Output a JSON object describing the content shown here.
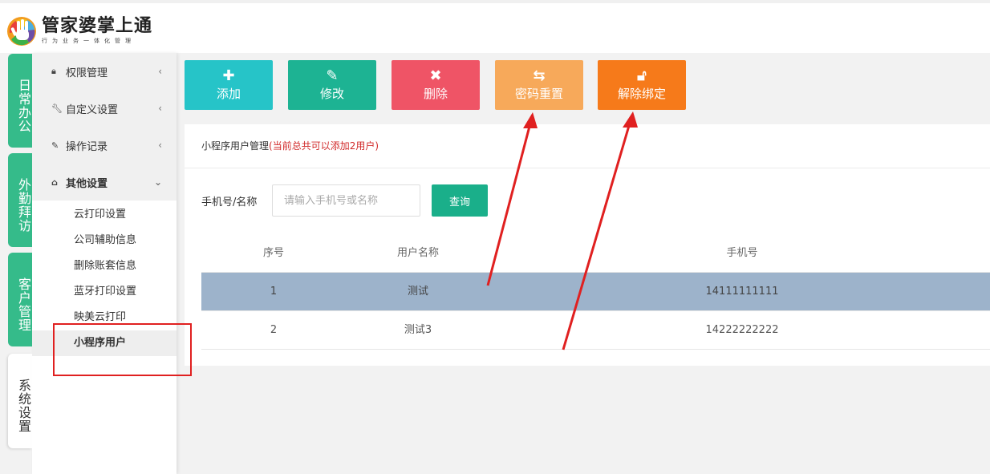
{
  "app": {
    "title": "管家婆掌上通",
    "subtitle": "行为业务一体化管理"
  },
  "vertical_tabs": [
    {
      "label": "日常办公",
      "state": "inactive"
    },
    {
      "label": "外勤拜访",
      "state": "inactive"
    },
    {
      "label": "客户管理",
      "state": "inactive"
    },
    {
      "label": "系统设置",
      "state": "active"
    }
  ],
  "sidebar": {
    "menus": [
      {
        "label": "权限管理",
        "icon": "lock-icon",
        "caret": "‹"
      },
      {
        "label": "自定义设置",
        "icon": "wrench-icon",
        "caret": "‹"
      },
      {
        "label": "操作记录",
        "icon": "edit-icon",
        "caret": "‹"
      },
      {
        "label": "其他设置",
        "icon": "home-icon",
        "caret": "⌄"
      }
    ],
    "sub_items": [
      "云打印设置",
      "公司辅助信息",
      "删除账套信息",
      "蓝牙打印设置",
      "映美云打印",
      "小程序用户"
    ]
  },
  "toolbar": {
    "buttons": [
      {
        "label": "添加",
        "icon": "plus-icon",
        "color": "#26c4c8"
      },
      {
        "label": "修改",
        "icon": "pencil-icon",
        "color": "#1db393"
      },
      {
        "label": "删除",
        "icon": "close-icon",
        "color": "#ef5466"
      },
      {
        "label": "密码重置",
        "icon": "refresh-icon",
        "color": "#f7a95a"
      },
      {
        "label": "解除绑定",
        "icon": "unlock-icon",
        "color": "#f67a1a"
      }
    ]
  },
  "panel": {
    "title": "小程序用户管理",
    "note": "(当前总共可以添加2用户)"
  },
  "search": {
    "label": "手机号/名称",
    "placeholder": "请输入手机号或名称",
    "value": "",
    "button": "查询"
  },
  "table": {
    "headers": [
      "序号",
      "用户名称",
      "手机号"
    ],
    "rows": [
      {
        "index": "1",
        "name": "测试",
        "phone": "14111111111",
        "selected": true
      },
      {
        "index": "2",
        "name": "测试3",
        "phone": "14222222222",
        "selected": false
      }
    ]
  },
  "colors": {
    "green_tab": "#35bb8a",
    "query_button": "#1aaf8a",
    "selected_row": "#9db3cb",
    "annotation_red": "#e02020",
    "note_red": "#d12a2a"
  }
}
